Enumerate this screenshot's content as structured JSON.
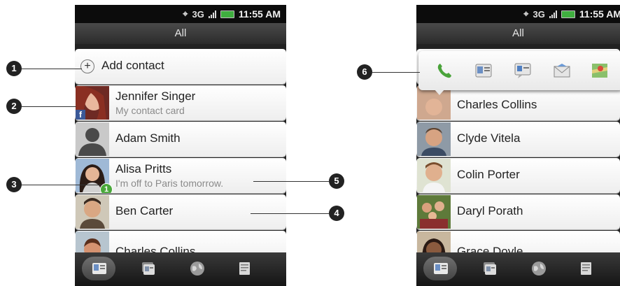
{
  "status": {
    "network": "3G",
    "time": "11:55 AM"
  },
  "left": {
    "title": "All",
    "add_contact": "Add contact",
    "contacts": [
      {
        "name": "Jennifer Singer",
        "sub": "My contact card",
        "badge": "f"
      },
      {
        "name": "Adam Smith",
        "sub": ""
      },
      {
        "name": "Alisa Pritts",
        "sub": "I'm off to Paris tomorrow.",
        "badge": "1"
      },
      {
        "name": "Ben  Carter",
        "sub": ""
      },
      {
        "name": "Charles  Collins",
        "sub": ""
      }
    ]
  },
  "right": {
    "title": "All",
    "contacts": [
      {
        "name": "Charles  Collins"
      },
      {
        "name": "Clyde Vitela"
      },
      {
        "name": "Colin Porter"
      },
      {
        "name": "Daryl Porath"
      },
      {
        "name": "Grace Doyle"
      }
    ],
    "quick_actions": [
      "phone-icon",
      "contact-card-icon",
      "message-icon",
      "email-icon",
      "map-icon"
    ]
  },
  "tabs": [
    "contacts-tab-icon",
    "groups-tab-icon",
    "online-directories-tab-icon",
    "call-history-tab-icon"
  ],
  "callouts": [
    "1",
    "2",
    "3",
    "4",
    "5",
    "6"
  ],
  "colors": {
    "facebook": "#3b5998",
    "update_badge": "#49a83a",
    "battery": "#3fae3f"
  }
}
